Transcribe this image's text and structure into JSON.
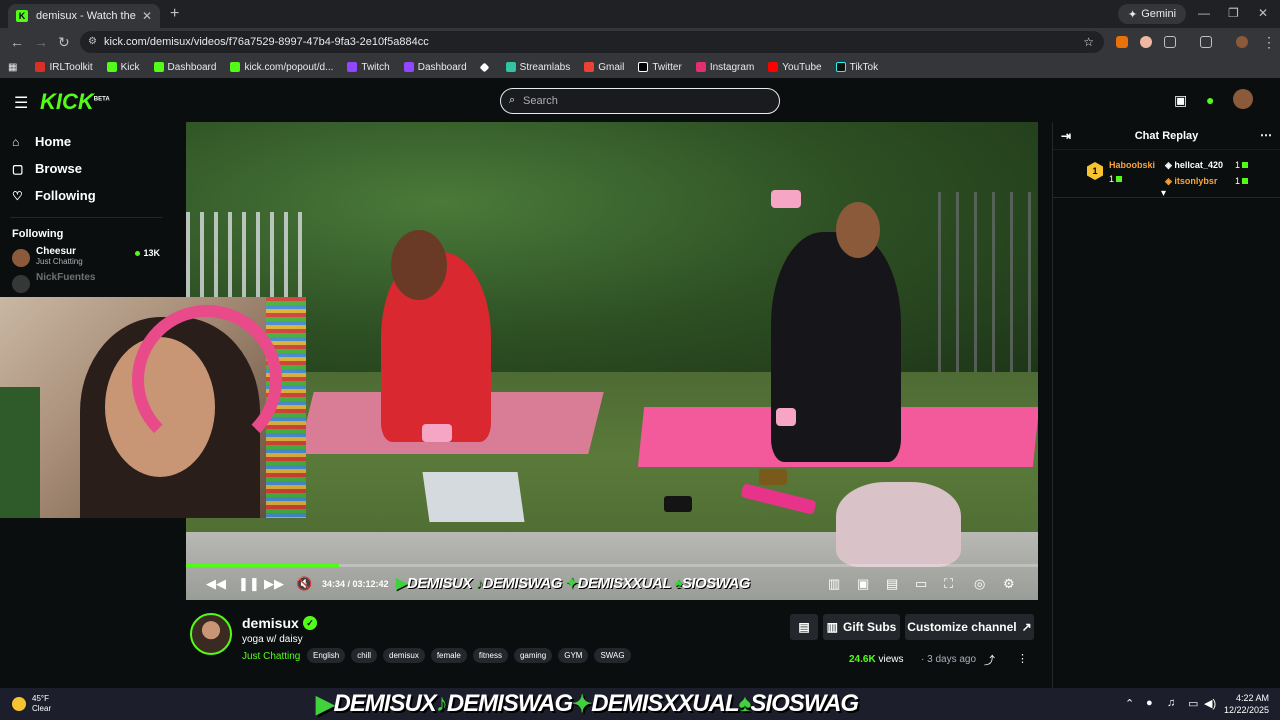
{
  "browser": {
    "tab_title": "demisux - Watch the VOD on K",
    "tab_favicon": "K",
    "new_tab": "+",
    "gemini_label": "Gemini",
    "url": "kick.com/demisux/videos/f76a7529-8997-47b4-9fa3-2e10f5a884cc",
    "bookmarks": [
      "IRLToolkit",
      "Kick",
      "Dashboard",
      "kick.com/popout/d...",
      "Twitch",
      "Dashboard",
      "Streamlabs",
      "Gmail",
      "Twitter",
      "Instagram",
      "YouTube",
      "TikTok"
    ]
  },
  "header": {
    "logo": "KICK",
    "logo_badge": "BETA",
    "search_placeholder": "Search"
  },
  "sidebar": {
    "nav": [
      {
        "label": "Home",
        "icon": "home-icon"
      },
      {
        "label": "Browse",
        "icon": "browse-icon"
      },
      {
        "label": "Following",
        "icon": "heart-icon"
      }
    ],
    "following_heading": "Following",
    "channels": [
      {
        "name": "Cheesur",
        "category": "Just Chatting",
        "viewers": "13K"
      },
      {
        "name": "NickFuentes",
        "category": "",
        "viewers": ""
      }
    ]
  },
  "player": {
    "time": "34:34 / 03:12:42",
    "progress_fraction": 0.179,
    "overlay_banner": [
      "DEMISUX",
      "DEMISWAG",
      "DEMISXXUAL",
      "SIOSWAG"
    ]
  },
  "chat": {
    "title": "Chat Replay",
    "leaderboard": [
      {
        "rank": "1",
        "name": "Haboobski",
        "count": "1",
        "color": "#f7a43a"
      },
      {
        "name": "hellcat_420",
        "count": "1",
        "color": "#ffffff"
      },
      {
        "name": "itsonlybsr",
        "count": "1",
        "color": "#f7a43a"
      }
    ]
  },
  "channel": {
    "name": "demisux",
    "video_title": "yoga w/ daisy",
    "category": "Just Chatting",
    "tags": [
      "English",
      "chill",
      "demisux",
      "female",
      "fitness",
      "gaming",
      "GYM",
      "SWAG"
    ],
    "gift_subs_label": "Gift Subs",
    "customize_label": "Customize channel",
    "views_count": "24.6K",
    "views_word": "views",
    "posted_ago": "3 days ago"
  },
  "taskbar": {
    "temp": "45°F",
    "condition": "Clear",
    "banner": [
      "DEMISUX",
      "DEMISWAG",
      "DEMISXXUAL",
      "SIOSWAG"
    ],
    "time": "4:22 AM",
    "date": "12/22/2025"
  },
  "colors": {
    "brand": "#53fc18",
    "background": "#0b0e0f",
    "panel": "#24272c"
  }
}
